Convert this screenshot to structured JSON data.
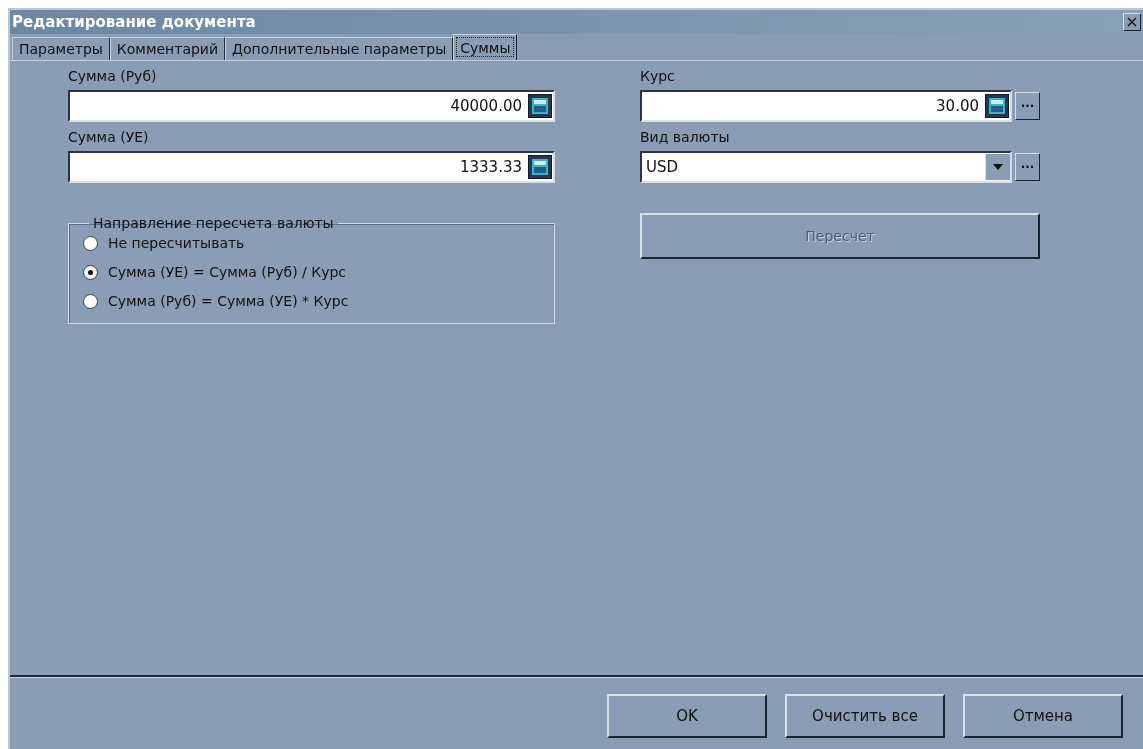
{
  "window": {
    "title": "Редактирование документа",
    "close": "×"
  },
  "tabs": [
    {
      "label": "Параметры",
      "selected": false
    },
    {
      "label": "Комментарий",
      "selected": false
    },
    {
      "label": "Дополнительные параметры",
      "selected": false
    },
    {
      "label": "Суммы",
      "selected": true
    }
  ],
  "left_fields": [
    {
      "label": "Сумма (Руб)",
      "value": "40000.00"
    },
    {
      "label": "Сумма (УЕ)",
      "value": "1333.33"
    }
  ],
  "rate": {
    "label": "Курс",
    "value": "30.00",
    "more": "···"
  },
  "currency": {
    "label": "Вид валюты",
    "value": "USD",
    "more": "···"
  },
  "recalc_button": {
    "label": "Пересчет",
    "disabled": true
  },
  "direction_group": {
    "title": "Направление пересчета валюты",
    "options": [
      {
        "label": "Не пересчитывать",
        "selected": false
      },
      {
        "label": "Сумма (УЕ) = Сумма (Руб) / Курс",
        "selected": true
      },
      {
        "label": "Сумма (Руб) = Сумма (УЕ) * Курс",
        "selected": false
      }
    ]
  },
  "buttons": [
    {
      "label": "OK"
    },
    {
      "label": "Очистить все"
    },
    {
      "label": "Отмена"
    }
  ]
}
